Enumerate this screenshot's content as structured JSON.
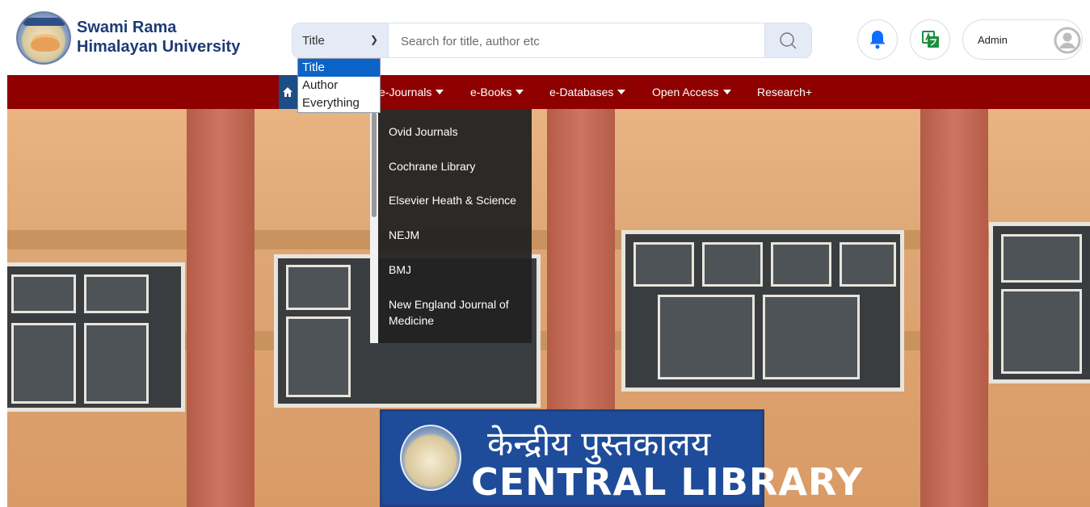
{
  "brand": {
    "line1": "Swami Rama",
    "line2": "Himalayan University"
  },
  "search": {
    "selected": "Title",
    "placeholder": "Search for title, author etc",
    "options": [
      "Title",
      "Author",
      "Everything"
    ]
  },
  "header": {
    "admin_label": "Admin"
  },
  "nav": {
    "items": [
      {
        "label": "e-Journals"
      },
      {
        "label": "e-Books"
      },
      {
        "label": "e-Databases"
      },
      {
        "label": "Open Access"
      },
      {
        "label": "Research+"
      }
    ]
  },
  "menu": {
    "items": [
      "Ovid Journals",
      "Cochrane Library",
      "Elsevier Heath & Science",
      "NEJM",
      "BMJ",
      "New England Journal of Medicine"
    ]
  },
  "hero": {
    "sign_hindi": "केन्द्रीय पुस्तकालय",
    "sign_english": "CENTRAL LIBRARY"
  },
  "colors": {
    "brand_blue": "#1d3b77",
    "nav_red": "#8f0000",
    "home_blue": "#1d4d86",
    "bell": "#0d6efd",
    "translate_green": "#1e8e3e"
  }
}
